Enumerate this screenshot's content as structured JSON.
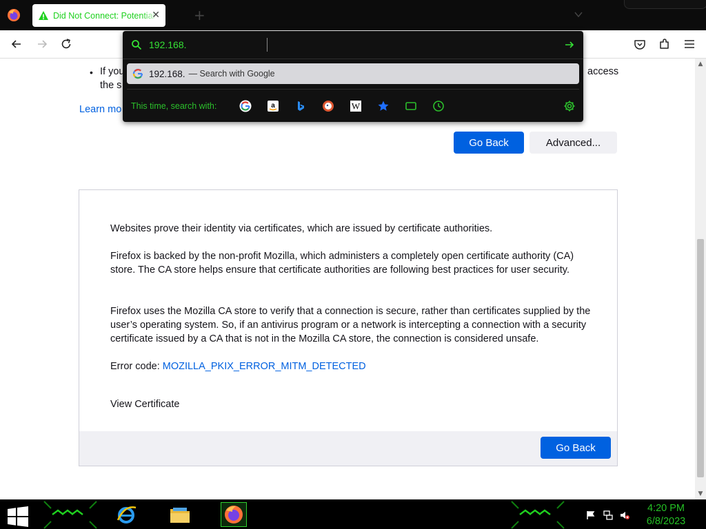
{
  "tab": {
    "title": "Did Not Connect: Potential Security Issue",
    "close": "✕",
    "new_tab": "+"
  },
  "urlbar": {
    "value": "192.168.",
    "suggestion_query": "192.168.",
    "suggestion_action": "— Search with Google",
    "oneoff_label": "This time, search with:",
    "engines": [
      "google-icon",
      "amazon-icon",
      "bing-icon",
      "duckduckgo-icon",
      "wikipedia-icon",
      "bookmarks-icon",
      "tabs-icon",
      "history-icon"
    ]
  },
  "page": {
    "bullet_prefix": "If you",
    "bullet_suffix": "access",
    "bullet_line2": "the s",
    "learn_more": "Learn mo",
    "go_back": "Go Back",
    "advanced": "Advanced...",
    "panel": {
      "p1": "Websites prove their identity via certificates, which are issued by certificate authorities.",
      "p2": "Firefox is backed by the non-profit Mozilla, which administers a completely open certificate authority (CA) store. The CA store helps ensure that certificate authorities are following best practices for user security.",
      "p3": "Firefox uses the Mozilla CA store to verify that a connection is secure, rather than certificates supplied by the user’s operating system. So, if an antivirus program or a network is intercepting a connection with a security certificate issued by a CA that is not in the Mozilla CA store, the connection is considered unsafe.",
      "error_label": "Error code: ",
      "error_code": "MOZILLA_PKIX_ERROR_MITM_DETECTED",
      "view_certificate": "View Certificate",
      "go_back": "Go Back"
    }
  },
  "taskbar": {
    "time": "4:20 PM",
    "date": "6/8/2023"
  },
  "colors": {
    "accent_green": "#2cc02c",
    "firefox_blue": "#0061e0"
  }
}
